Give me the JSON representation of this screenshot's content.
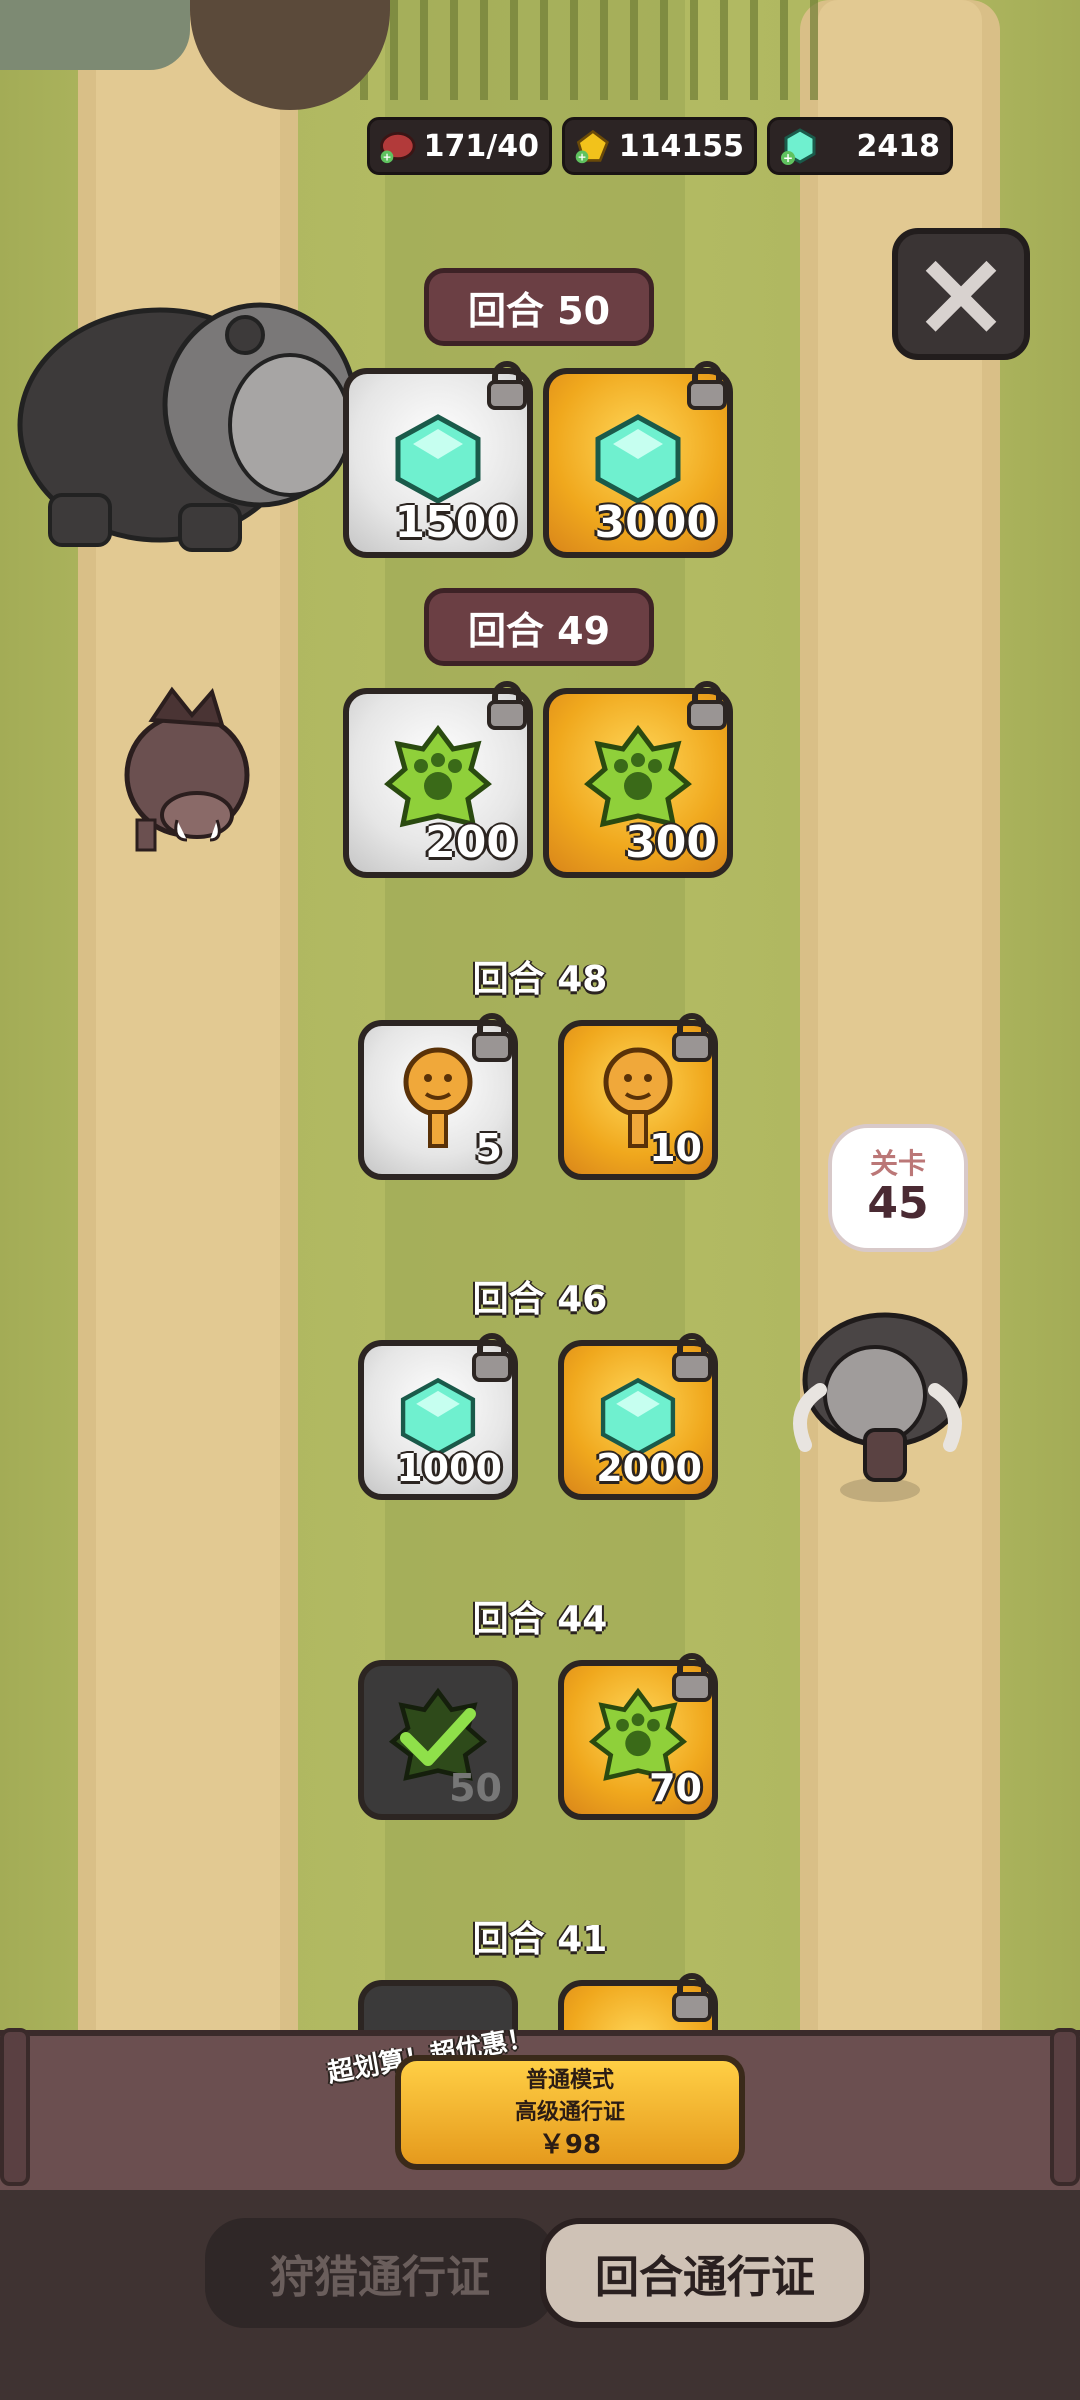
{
  "resources": {
    "meat": {
      "icon": "meat-icon",
      "value": "171/40"
    },
    "gold": {
      "icon": "gold-icon",
      "value": "114155"
    },
    "gems": {
      "icon": "gem-icon",
      "value": "2418"
    }
  },
  "close_icon": "close-icon",
  "rounds": [
    {
      "label": "回合 50",
      "free": {
        "item": "gem",
        "amount": "1500",
        "locked": true
      },
      "premium": {
        "item": "gem",
        "amount": "3000",
        "locked": true
      }
    },
    {
      "label": "回合 49",
      "free": {
        "item": "paw-token",
        "amount": "200",
        "locked": true
      },
      "premium": {
        "item": "paw-token",
        "amount": "300",
        "locked": true
      }
    },
    {
      "label": "回合 48",
      "free": {
        "item": "key",
        "amount": "5",
        "locked": true
      },
      "premium": {
        "item": "key",
        "amount": "10",
        "locked": true
      }
    },
    {
      "label": "回合 46",
      "free": {
        "item": "gem",
        "amount": "1000",
        "locked": true
      },
      "premium": {
        "item": "gem",
        "amount": "2000",
        "locked": true
      }
    },
    {
      "label": "回合 44",
      "free": {
        "item": "paw-token",
        "amount": "50",
        "claimed": true
      },
      "premium": {
        "item": "paw-token",
        "amount": "70",
        "locked": true
      }
    },
    {
      "label": "回合 41"
    }
  ],
  "stage_bubble": {
    "title": "关卡",
    "number": "45"
  },
  "promo": {
    "tag": "超划算！超优惠！",
    "line1": "普通模式",
    "line2": "高级通行证",
    "price": "￥98"
  },
  "tabs": [
    {
      "label": "狩猎通行证",
      "active": false
    },
    {
      "label": "回合通行证",
      "active": true
    }
  ]
}
